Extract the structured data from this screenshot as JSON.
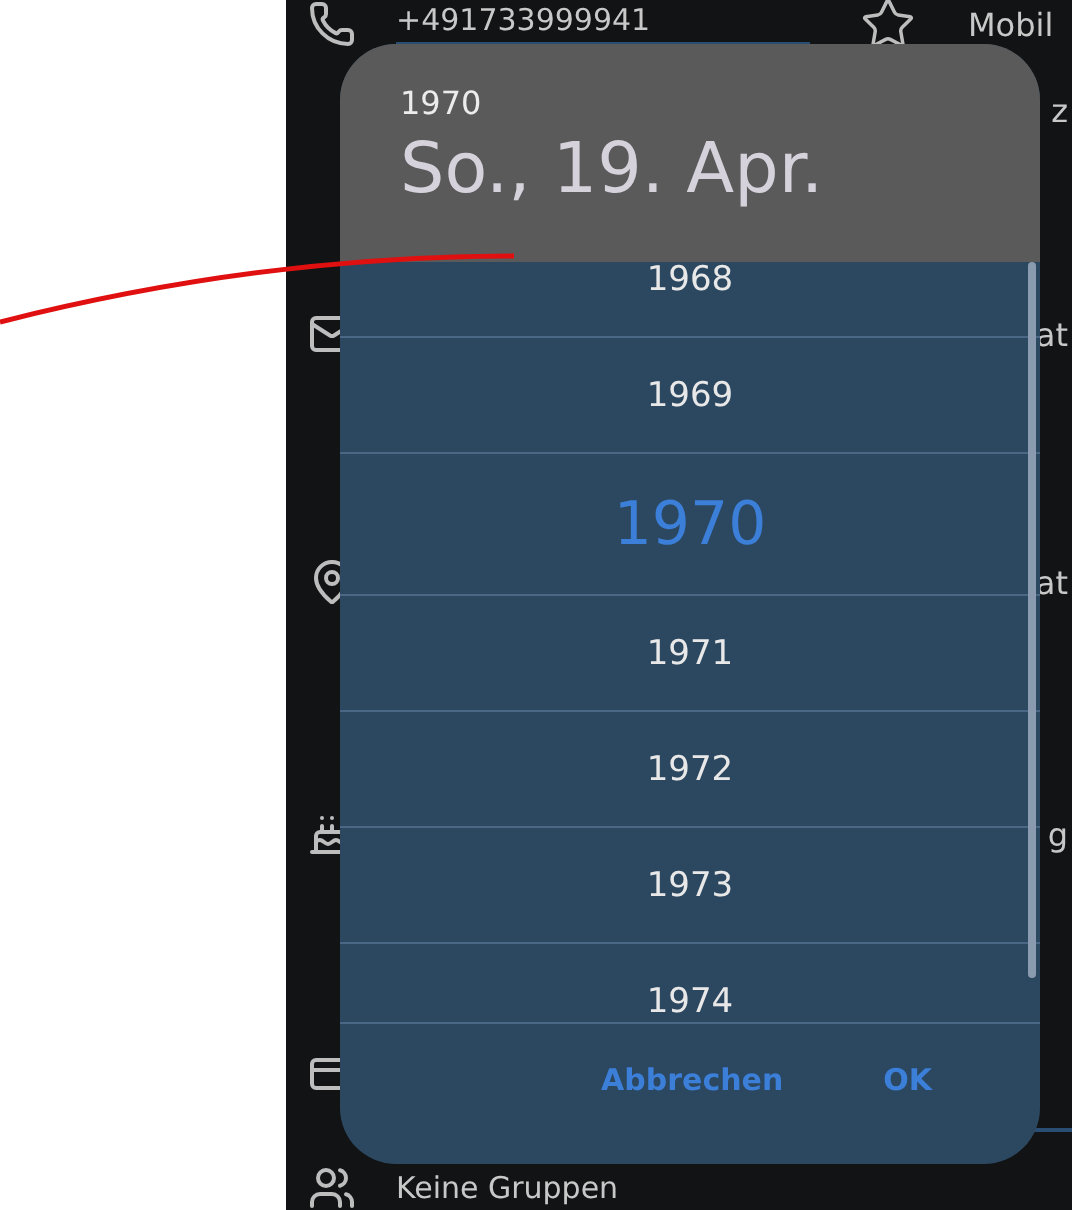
{
  "contact_form": {
    "phone": {
      "number": "+491733999941",
      "type": "Mobil"
    },
    "rows": [
      {
        "kind": "phone"
      },
      {
        "kind": "note",
        "label": "z"
      },
      {
        "kind": "email",
        "label": "at"
      },
      {
        "kind": "address",
        "label": "at"
      },
      {
        "kind": "birthday",
        "label": "g"
      },
      {
        "kind": "card"
      },
      {
        "kind": "groups",
        "label": "Keine Gruppen"
      }
    ]
  },
  "dialog": {
    "header_year": "1970",
    "date": "So., 19. Apr.",
    "years": [
      {
        "label": "1968",
        "selected": false
      },
      {
        "label": "1969",
        "selected": false
      },
      {
        "label": "1970",
        "selected": true
      },
      {
        "label": "1971",
        "selected": false
      },
      {
        "label": "1972",
        "selected": false
      },
      {
        "label": "1973",
        "selected": false
      },
      {
        "label": "1974",
        "selected": false
      }
    ],
    "buttons": [
      {
        "label": "Abbrechen"
      },
      {
        "label": "OK"
      }
    ]
  }
}
